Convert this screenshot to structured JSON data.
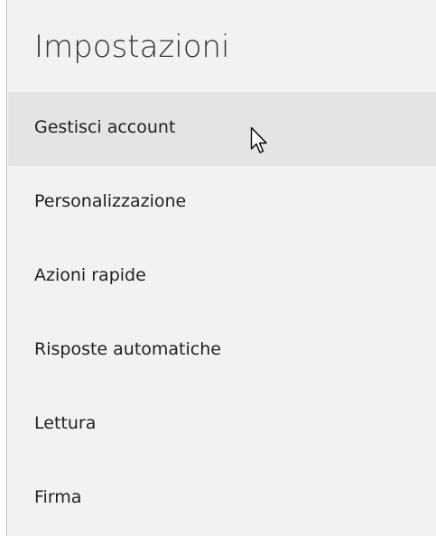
{
  "settings": {
    "title": "Impostazioni",
    "items": [
      {
        "label": "Gestisci account"
      },
      {
        "label": "Personalizzazione"
      },
      {
        "label": "Azioni rapide"
      },
      {
        "label": "Risposte automatiche"
      },
      {
        "label": "Lettura"
      },
      {
        "label": "Firma"
      }
    ],
    "hovered_index": 0,
    "colors": {
      "panel_bg": "#f2f2f2",
      "hover_bg": "#e4e4e4",
      "text": "#1f1f1f",
      "title": "#333333"
    }
  },
  "cursor": {
    "icon": "mouse-pointer-icon"
  }
}
